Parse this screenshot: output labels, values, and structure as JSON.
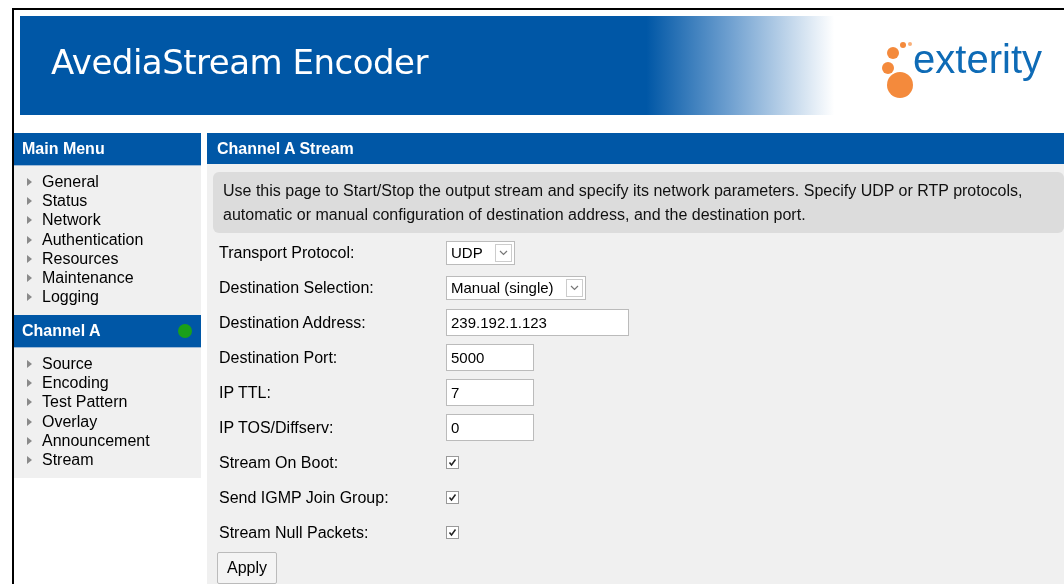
{
  "header": {
    "title": "AvediaStream Encoder",
    "logo_text": "exterity"
  },
  "sidebar": {
    "sections": [
      {
        "title": "Main Menu",
        "items": [
          "General",
          "Status",
          "Network",
          "Authentication",
          "Resources",
          "Maintenance",
          "Logging"
        ]
      },
      {
        "title": "Channel A",
        "color": "#1aa01a",
        "items": [
          "Source",
          "Encoding",
          "Test Pattern",
          "Overlay",
          "Announcement",
          "Stream"
        ]
      }
    ]
  },
  "content": {
    "title": "Channel A Stream",
    "description": "Use this page to Start/Stop the output stream and specify its network parameters. Specify UDP or RTP protocols, automatic or manual configuration of destination address, and the destination port.",
    "fields": [
      {
        "kind": "select",
        "label": "Transport Protocol:",
        "value": "UDP"
      },
      {
        "kind": "select",
        "label": "Destination Selection:",
        "value": "Manual (single)"
      },
      {
        "kind": "text",
        "label": "Destination Address:",
        "value": "239.192.1.123"
      },
      {
        "kind": "text",
        "label": "Destination Port:",
        "value": "5000"
      },
      {
        "kind": "text",
        "label": "IP TTL:",
        "value": "7"
      },
      {
        "kind": "text",
        "label": "IP TOS/Diffserv:",
        "value": "0"
      },
      {
        "kind": "checkbox",
        "label": "Stream On Boot:",
        "checked": true
      },
      {
        "kind": "checkbox",
        "label": "Send IGMP Join Group:",
        "checked": true
      },
      {
        "kind": "checkbox",
        "label": "Stream Null Packets:",
        "checked": true
      }
    ],
    "button": "Apply"
  }
}
